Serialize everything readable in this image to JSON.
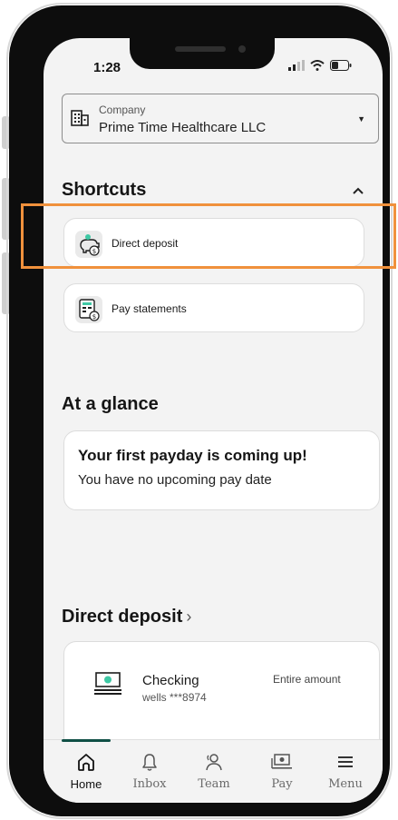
{
  "status": {
    "time": "1:28"
  },
  "company": {
    "caption": "Company",
    "value": "Prime Time Healthcare LLC"
  },
  "shortcuts": {
    "title": "Shortcuts",
    "items": [
      {
        "label": "Direct deposit",
        "icon": "piggy-bank-icon"
      },
      {
        "label": "Pay statements",
        "icon": "pay-statement-icon"
      }
    ]
  },
  "glance": {
    "title": "At a glance",
    "card_title": "Your first payday is coming up!",
    "card_text": "You have no upcoming pay date"
  },
  "direct_deposit": {
    "title": "Direct deposit",
    "account_name": "Checking",
    "account_detail": "wells  ***8974",
    "amount_label": "Entire amount"
  },
  "tabs": [
    {
      "label": "Home",
      "icon": "home-icon",
      "active": true
    },
    {
      "label": "Inbox",
      "icon": "bell-icon"
    },
    {
      "label": "Team",
      "icon": "team-icon"
    },
    {
      "label": "Pay",
      "icon": "pay-icon"
    },
    {
      "label": "Menu",
      "icon": "menu-icon"
    }
  ],
  "colors": {
    "accent": "#0f4f45",
    "highlight": "#f0913c",
    "icon_green": "#3ec8a4"
  }
}
